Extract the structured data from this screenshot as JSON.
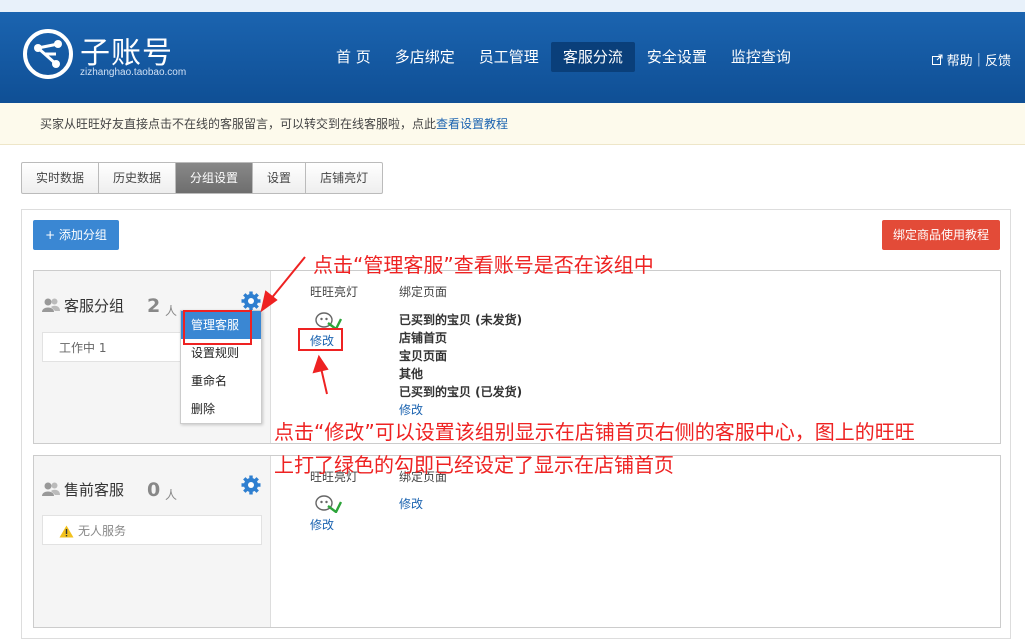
{
  "brand": {
    "title": "子账号",
    "subtitle": "zizhanghao.taobao.com"
  },
  "nav": {
    "items": [
      "首 页",
      "多店绑定",
      "员工管理",
      "客服分流",
      "安全设置",
      "监控查询"
    ],
    "active_index": 3
  },
  "header_links": {
    "help": "帮助",
    "sep": "|",
    "feedback": "反馈"
  },
  "notice": {
    "text": "买家从旺旺好友直接点击不在线的客服留言，可以转交到在线客服啦，点此",
    "link": "查看设置教程"
  },
  "tabs": {
    "items": [
      "实时数据",
      "历史数据",
      "分组设置",
      "设置",
      "店铺亮灯"
    ],
    "active_index": 2
  },
  "toolbar": {
    "add_group": "+ 添加分组",
    "tutorial": "绑定商品使用教程"
  },
  "columns": {
    "light": "旺旺亮灯",
    "bind": "绑定页面"
  },
  "groups": [
    {
      "name": "客服分组",
      "count": "2",
      "unit": "人",
      "status": "工作中  1",
      "edit": "修改",
      "pages": [
        "已买到的宝贝 (未发货)",
        "店铺首页",
        "宝贝页面",
        "其他",
        "已买到的宝贝 (已发货)"
      ],
      "pages_edit": "修改",
      "light_on": true
    },
    {
      "name": "售前客服",
      "count": "0",
      "unit": "人",
      "status": "无人服务",
      "edit": "修改",
      "pages_edit": "修改",
      "light_on": true
    }
  ],
  "context_menu": {
    "items": [
      "管理客服",
      "设置规则",
      "重命名",
      "删除"
    ],
    "active_index": 0
  },
  "annotations": {
    "a1": "点击“管理客服”查看账号是否在该组中",
    "a2_line1": "点击“修改”可以设置该组别显示在店铺首页右侧的客服中心，图上的旺旺",
    "a2_line2": "上打了绿色的勾即已经设定了显示在店铺首页"
  },
  "colors": {
    "header": "#1b64b0",
    "nav_active": "#0a3f7a",
    "primary_button": "#3a87d3",
    "danger_button": "#e34b38",
    "annotation": "#ee2222",
    "link": "#1b63b0",
    "check": "#2da43a"
  },
  "icons": [
    "logo-icon",
    "external-link-icon",
    "users-icon",
    "gear-icon",
    "wangwang-icon",
    "check-icon",
    "warning-icon"
  ]
}
